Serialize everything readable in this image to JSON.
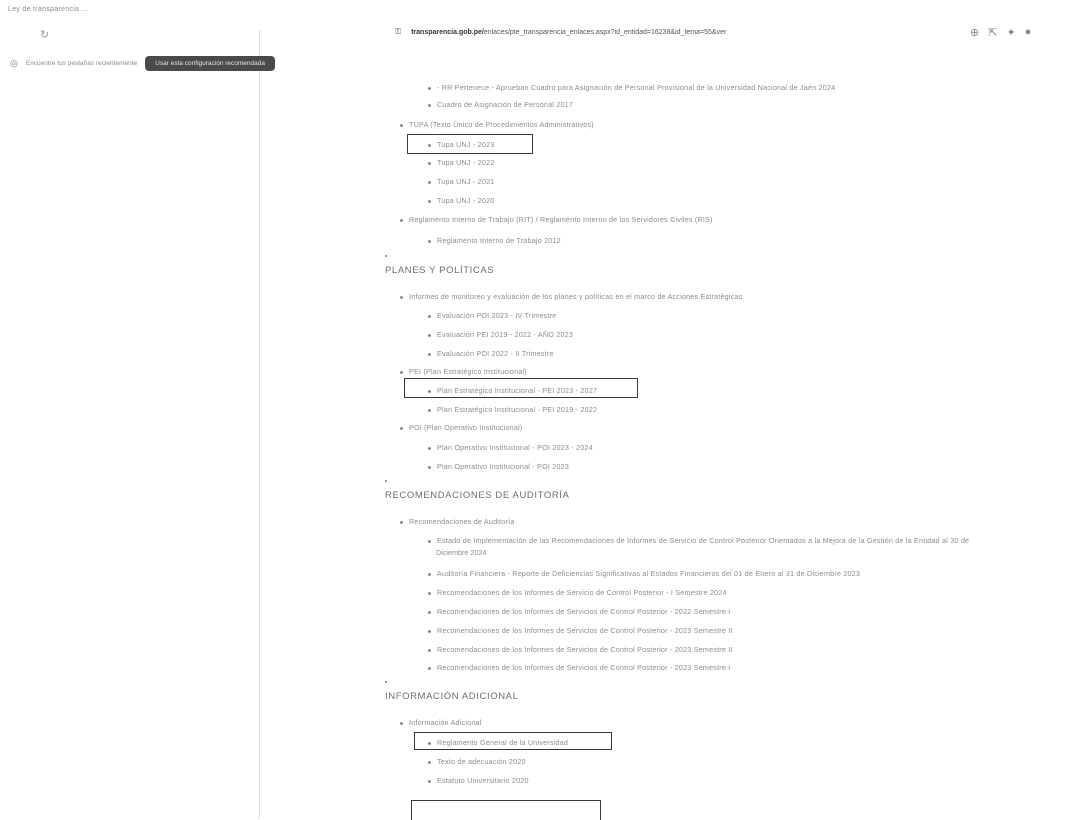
{
  "browser": {
    "tab_title": "Ley de transparencia ...",
    "url_prefix": "transparencia.gob.pe/",
    "url_rest": "enlaces/pte_transparencia_enlaces.aspx?id_entidad=16238&id_tema=55&ver",
    "notice_text": "Encuentre tus pestañas recientemente",
    "notice_button": "Usar esta configuración recomendada"
  },
  "sections": {
    "transparencia_items": [
      "- RR Pertenece - Aprueban Cuadro para Asignación de Personal Provisional de la Universidad Nacional de Jaén 2024",
      "Cuadro de Asignación de Personal 2017",
      "TUPA (Texto Único de Procedimientos Administrativos)",
      "Tupa UNJ - 2023",
      "Tupa UNJ - 2022",
      "Tupa UNJ - 2021",
      "Tupa UNJ - 2020",
      "Reglamento Interno de Trabajo (RIT) / Reglamento Interno de los Servidores Civiles (RIS)",
      "Reglamento Interno de Trabajo 2012"
    ],
    "planes_heading": "PLANES Y POLÍTICAS",
    "planes_items": [
      "Informes de monitoreo y evaluación de los planes y políticas en el marco de Acciones Estratégicas",
      "Evaluación POI 2023 - IV Trimestre",
      "Evaluación PEI 2019 - 2022 - AÑO 2023",
      "Evaluación POI 2022 - II Trimestre",
      "PEI (Plan Estratégico Institucional)",
      "Plan Estratégico Institucional - PEI 2023 - 2027",
      "Plan Estratégico Institucional - PEI 2019 - 2022",
      "POI (Plan Operativo Institucional)",
      "Plan Operativo Institucional - POI 2023 - 2024",
      "Plan Operativo Institucional - POI 2023"
    ],
    "auditoria_heading": "RECOMENDACIONES DE AUDITORÍA",
    "auditoria_items": [
      "Recomendaciones de Auditoría",
      "Estado de Implementación de las Recomendaciones de Informes de Servicio de Control Posterior Orientados a la Mejora de la Gestión de la Entidad al 30 de",
      "Diciembre 2024",
      "Auditoría Financiera - Reporte de Deficiencias Significativas al Estados Financieros del 01 de Enero al 31 de Diciembre 2023",
      "Recomendaciones de los Informes de Servicio de Control Posterior - I Semestre 2024",
      "Recomendaciones de los Informes de Servicios de Control Posterior - 2022 Semestre I",
      "Recomendaciones de los Informes de Servicios de Control Posterior - 2023 Semestre II",
      "Recomendaciones de los Informes de Servicios de Control Posterior - 2023 Semestre II",
      "Recomendaciones de los Informes de Servicios de Control Posterior - 2023 Semestre I"
    ],
    "adicional_heading": "INFORMACIÓN ADICIONAL",
    "adicional_items": [
      "Información Adicional",
      "Reglamento General de la Universidad",
      "Texto de adecuación 2020",
      "Estatuto Universitario 2020"
    ]
  }
}
